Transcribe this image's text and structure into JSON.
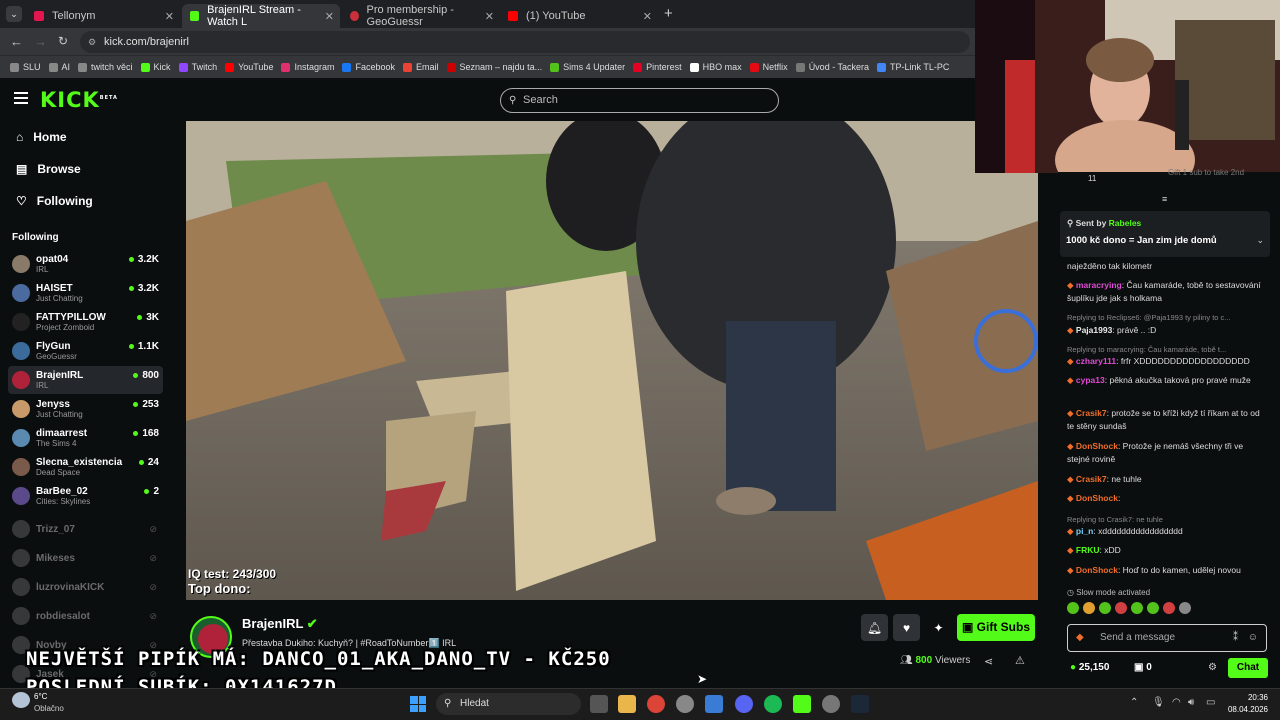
{
  "browser": {
    "tabs": [
      {
        "title": "Tellonym",
        "color": "#e3164f"
      },
      {
        "title": "BrajenIRL Stream - Watch L",
        "color": "#53fc18"
      },
      {
        "title": "Pro membership - GeoGuessr",
        "color": "#c9303a"
      },
      {
        "title": "(1) YouTube",
        "color": "#ff0000"
      }
    ],
    "url": "kick.com/brajenirl",
    "bookmarks": [
      "SLU",
      "AI",
      "twitch věci",
      "Kick",
      "Twitch",
      "YouTube",
      "Instagram",
      "Facebook",
      "Email",
      "Seznam – najdu ta...",
      "Sims 4 Updater",
      "Pinterest",
      "HBO max",
      "Netflix",
      "Úvod - Tackera",
      "TP-Link TL-PC"
    ]
  },
  "kick": {
    "logo": "KICK",
    "logo_badge": "BETA",
    "search_placeholder": "Search",
    "nav": [
      "Home",
      "Browse",
      "Following"
    ],
    "following_header": "Following",
    "following": [
      {
        "name": "opat04",
        "cat": "IRL",
        "count": "3.2K",
        "color": "#8a7a6a"
      },
      {
        "name": "HAISET",
        "cat": "Just Chatting",
        "count": "3.2K",
        "color": "#4a6aa0"
      },
      {
        "name": "FATTYPILLOW",
        "cat": "Project Zomboid",
        "count": "3K",
        "color": "#222222"
      },
      {
        "name": "FlyGun",
        "cat": "GeoGuessr",
        "count": "1.1K",
        "color": "#3a6b9a"
      },
      {
        "name": "BrajenIRL",
        "cat": "IRL",
        "count": "800",
        "color": "#b0223a"
      },
      {
        "name": "Jenyss",
        "cat": "Just Chatting",
        "count": "253",
        "color": "#c89a6a"
      },
      {
        "name": "dimaarrest",
        "cat": "The Sims 4",
        "count": "168",
        "color": "#5a8ab0"
      },
      {
        "name": "Slecna_existencia",
        "cat": "Dead Space",
        "count": "24",
        "color": "#7a5a4a"
      },
      {
        "name": "BarBee_02",
        "cat": "Cities: Skylines",
        "count": "2",
        "color": "#5a4a8a"
      }
    ],
    "offline": [
      "Trizz_07",
      "Mikeses",
      "luzrovinaKICK",
      "robdiesalot",
      "Novby",
      "Jasek"
    ]
  },
  "stream": {
    "overlay_iq": "IQ test: 243/300",
    "overlay_top": "Top dono:",
    "streamer": "BrajenIRL",
    "title": "Přestavba Dukiho: Kuchyň? | #RoadToNumber1️⃣ IRL",
    "viewers": "800",
    "viewers_label": "Viewers",
    "gift_label": "Gift Subs",
    "ovl_line1": "NEJVĚTŠÍ PIPÍK MÁ: DANCO_01_AKA_DANO_TV - KČ250",
    "ovl_line2": "POSLEDNÍ SUBÍK: 0X141627D"
  },
  "chat": {
    "top_count": "11",
    "top_gift": "Gift 1 sub to take 2nd",
    "pinned_by_label": "Sent by",
    "pinned_by": "Rabeles",
    "pinned_msg": "1000 kč dono = Jan zim jde domů",
    "messages": [
      {
        "user": "",
        "text": "naježděno tak kilometr",
        "color": "#ddd",
        "reply": false
      },
      {
        "user": "maracrying",
        "text": ": Čau kamaráde, tobě to sestavování šuplíku jde jak s holkama",
        "color": "#e14bd6",
        "reply": false
      },
      {
        "user": "",
        "text": "Replying to Reclipse6: @Paja1993 ty piliny to c...",
        "color": "#888",
        "reply": true
      },
      {
        "user": "Paja1993",
        "text": ": právě .. :D",
        "color": "#e9e9e9",
        "reply": false
      },
      {
        "user": "",
        "text": "Replying to maracrying: Čau kamaráde, tobě t...",
        "color": "#888",
        "reply": true
      },
      {
        "user": "czhary111",
        "text": ": frfr XDDDDDDDDDDDDDDDDDD",
        "color": "#e14bd6",
        "reply": false
      },
      {
        "user": "cypa13",
        "text": ": pěkná akučka taková pro pravé muže",
        "color": "#e14bd6",
        "reply": false
      },
      {
        "user": "Crasik7",
        "text": ": protože se to kříži když tí říkam at to od te stěny sundaš",
        "color": "#f06d2b",
        "reply": false
      },
      {
        "user": "DonShock",
        "text": ": Protože je nemáš všechny tři ve stejné rovině",
        "color": "#f06d2b",
        "reply": false
      },
      {
        "user": "Crasik7",
        "text": ": ne tuhle",
        "color": "#f06d2b",
        "reply": false
      },
      {
        "user": "DonShock",
        "text": ":",
        "color": "#f06d2b",
        "reply": false
      },
      {
        "user": "",
        "text": "Replying to Crasik7: ne tuhle",
        "color": "#888",
        "reply": true
      },
      {
        "user": "pi_n",
        "text": ": xddddddddddddddddd",
        "color": "#7cd1ff",
        "reply": false
      },
      {
        "user": "FRKU",
        "text": ": xDD",
        "color": "#53fc18",
        "reply": false
      },
      {
        "user": "DonShock",
        "text": ": Hoď to do kamen, udělej novou",
        "color": "#f06d2b",
        "reply": false
      }
    ],
    "slow_mode": "Slow mode activated",
    "input_placeholder": "Send a message",
    "points": "25,150",
    "count2": "0",
    "chat_button": "Chat"
  },
  "taskbar": {
    "temp": "6°C",
    "weather": "Oblačno",
    "search": "Hledat",
    "time": "20:36",
    "date": "08.04.2026"
  }
}
